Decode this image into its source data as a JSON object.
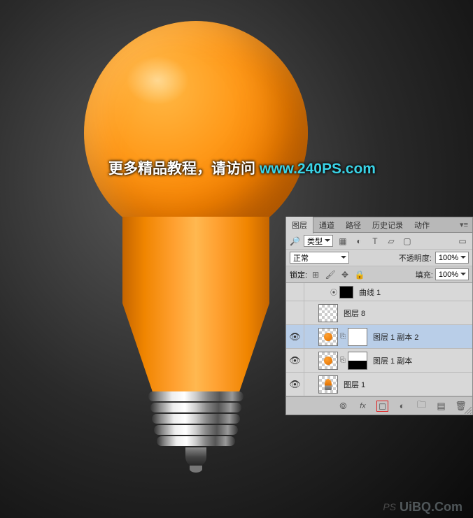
{
  "watermark": {
    "text_cn": "更多精品教程，请访问 ",
    "url": "www.240PS.com",
    "bottom_ps": "PS",
    "bottom_site": "UiBQ.Com"
  },
  "panel": {
    "tabs": {
      "layers": "图层",
      "channels": "通道",
      "paths": "路径",
      "history": "历史记录",
      "actions": "动作"
    },
    "type_filter": "类型",
    "blend_mode": "正常",
    "opacity_label": "不透明度:",
    "opacity_value": "100%",
    "lock_label": "锁定:",
    "fill_label": "填充:",
    "fill_value": "100%",
    "layers": [
      {
        "name": "曲线 1",
        "visible": false
      },
      {
        "name": "图层 8",
        "visible": false
      },
      {
        "name": "图层 1 副本 2",
        "visible": true,
        "selected": true
      },
      {
        "name": "图层 1 副本",
        "visible": true
      },
      {
        "name": "图层 1",
        "visible": true
      }
    ]
  }
}
